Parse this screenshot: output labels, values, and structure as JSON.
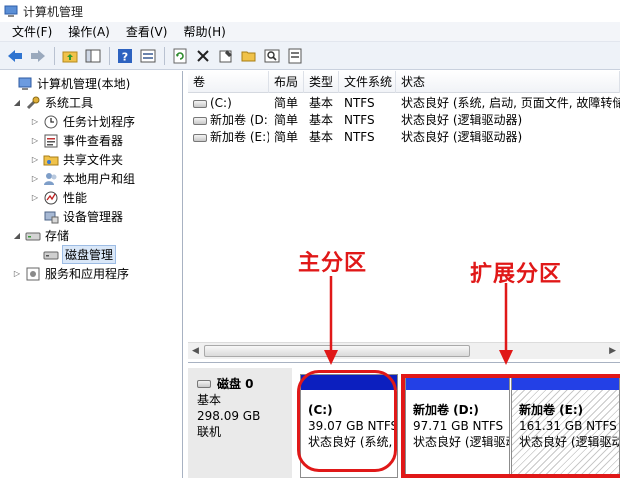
{
  "window": {
    "title": "计算机管理"
  },
  "menu": [
    "文件(F)",
    "操作(A)",
    "查看(V)",
    "帮助(H)"
  ],
  "toolbar": [
    "back-icon",
    "forward-icon",
    "up-folder-icon",
    "show-tree-icon",
    "help-icon",
    "view-icon",
    "refresh-icon",
    "delete-icon",
    "properties-icon",
    "open-folder-icon",
    "search-icon",
    "export-icon"
  ],
  "tree": [
    {
      "label": "计算机管理(本地)",
      "level": 0,
      "expander": "open",
      "icon": "computer-management-icon"
    },
    {
      "label": "系统工具",
      "level": 1,
      "expander": "open",
      "icon": "system-tools-icon"
    },
    {
      "label": "任务计划程序",
      "level": 2,
      "expander": "closed",
      "icon": "task-scheduler-icon"
    },
    {
      "label": "事件查看器",
      "level": 2,
      "expander": "closed",
      "icon": "event-viewer-icon"
    },
    {
      "label": "共享文件夹",
      "level": 2,
      "expander": "closed",
      "icon": "shared-folders-icon"
    },
    {
      "label": "本地用户和组",
      "level": 2,
      "expander": "closed",
      "icon": "local-users-icon"
    },
    {
      "label": "性能",
      "level": 2,
      "expander": "closed",
      "icon": "performance-icon"
    },
    {
      "label": "设备管理器",
      "level": 2,
      "expander": "none",
      "icon": "device-manager-icon"
    },
    {
      "label": "存储",
      "level": 1,
      "expander": "open",
      "icon": "storage-icon"
    },
    {
      "label": "磁盘管理",
      "level": 2,
      "expander": "none",
      "icon": "disk-management-icon",
      "selected": true
    },
    {
      "label": "服务和应用程序",
      "level": 1,
      "expander": "closed",
      "icon": "services-apps-icon"
    }
  ],
  "volumes": {
    "columns": [
      "卷",
      "布局",
      "类型",
      "文件系统",
      "状态"
    ],
    "rows": [
      [
        "(C:)",
        "简单",
        "基本",
        "NTFS",
        "状态良好 (系统, 启动, 页面文件, 故障转储, 主"
      ],
      [
        "新加卷 (D:)",
        "简单",
        "基本",
        "NTFS",
        "状态良好 (逻辑驱动器)"
      ],
      [
        "新加卷 (E:)",
        "简单",
        "基本",
        "NTFS",
        "状态良好 (逻辑驱动器)"
      ]
    ]
  },
  "disk": {
    "name": "磁盘 0",
    "type": "基本",
    "size": "298.09 GB",
    "status": "联机",
    "partitions": [
      {
        "name": "(C:)",
        "size": "39.07 GB NTFS",
        "status": "状态良好 (系统, 启"
      },
      {
        "name": "新加卷  (D:)",
        "size": "97.71 GB NTFS",
        "status": "状态良好 (逻辑驱动"
      },
      {
        "name": "新加卷  (E:)",
        "size": "161.31 GB NTFS",
        "status": "状态良好 (逻辑驱动"
      }
    ]
  },
  "annotations": {
    "primary": "主分区",
    "extended": "扩展分区"
  },
  "colors": {
    "annotation": "#e01818",
    "primary_bar": "#0c1fbf",
    "logical_bar": "#2340e6",
    "selection": "#d9e7f8"
  }
}
